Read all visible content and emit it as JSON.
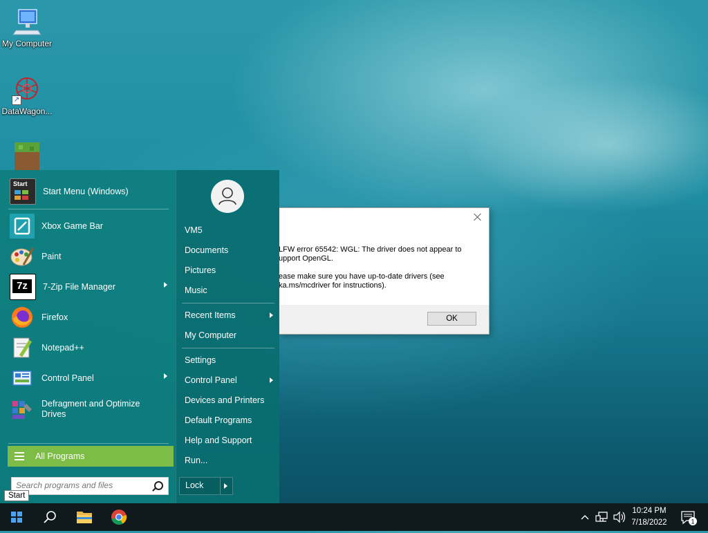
{
  "desktop": {
    "icons": [
      {
        "label": "My Computer"
      },
      {
        "label": "DataWagon..."
      }
    ]
  },
  "start_menu": {
    "programs": [
      {
        "label": "Start Menu (Windows)",
        "icon": "start-menu-app-icon"
      },
      {
        "label": "Xbox Game Bar",
        "icon": "xbox-game-bar-icon"
      },
      {
        "label": "Paint",
        "icon": "paint-icon"
      },
      {
        "label": "7-Zip File Manager",
        "icon": "7zip-icon",
        "submenu": true
      },
      {
        "label": "Firefox",
        "icon": "firefox-icon"
      },
      {
        "label": "Notepad++",
        "icon": "notepadpp-icon"
      },
      {
        "label": "Control Panel",
        "icon": "control-panel-icon",
        "submenu": true
      },
      {
        "label": "Defragment and Optimize Drives",
        "icon": "defrag-icon"
      }
    ],
    "start_icon_text": "Start",
    "all_programs_label": "All Programs",
    "search_placeholder": "Search programs and files",
    "right_items": [
      {
        "label": "VM5"
      },
      {
        "label": "Documents"
      },
      {
        "label": "Pictures"
      },
      {
        "label": "Music"
      },
      {
        "label": "Recent Items",
        "submenu": true
      },
      {
        "label": "My Computer"
      },
      {
        "label": "Settings"
      },
      {
        "label": "Control Panel",
        "submenu": true
      },
      {
        "label": "Devices and Printers"
      },
      {
        "label": "Default Programs"
      },
      {
        "label": "Help and Support"
      },
      {
        "label": "Run..."
      }
    ],
    "lock_label": "Lock"
  },
  "tooltip": {
    "text": "Start"
  },
  "dialog": {
    "line1": "LFW error 65542: WGL: The driver does not appear to\nupport OpenGL.",
    "line2": "ease make sure you have up-to-date drivers (see\nka.ms/mcdriver for instructions).",
    "ok_label": "OK"
  },
  "taskbar": {
    "time": "10:24 PM",
    "date": "7/18/2022",
    "notification_count": "1"
  },
  "colors": {
    "start_menu_left": "#0e7e7e",
    "start_menu_right": "#0a6e70",
    "all_programs_bar": "#7cbc47",
    "taskbar": "#101a1e"
  }
}
